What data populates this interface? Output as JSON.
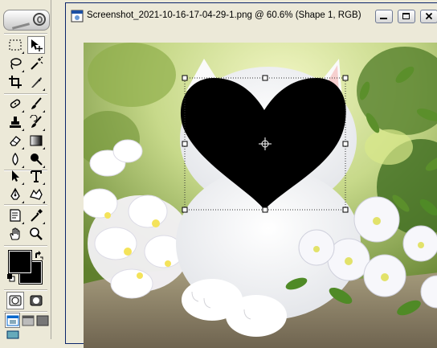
{
  "document": {
    "title": "Screenshot_2021-10-16-17-04-29-1.png @ 60.6% (Shape 1, RGB)"
  },
  "tools": {
    "active_tool": "path-selection-tool",
    "foreground_color": "#000000",
    "background_color": "#000000"
  },
  "colors": {
    "titlebar_border": "#0a246a",
    "shape_fill": "#000000"
  }
}
